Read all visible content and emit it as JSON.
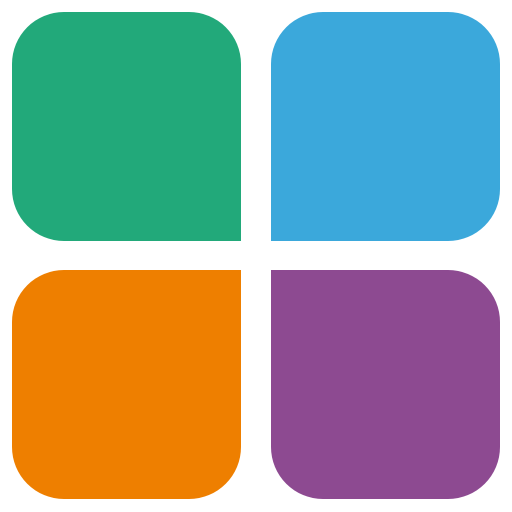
{
  "logo": {
    "name": "four-square-app-logo",
    "tiles": [
      {
        "id": "top-left",
        "color": "#22A97A"
      },
      {
        "id": "top-right",
        "color": "#3BA8DB"
      },
      {
        "id": "bottom-left",
        "color": "#EE7F00"
      },
      {
        "id": "bottom-right",
        "color": "#8D4A91"
      }
    ],
    "background": "#FFFFFF"
  }
}
